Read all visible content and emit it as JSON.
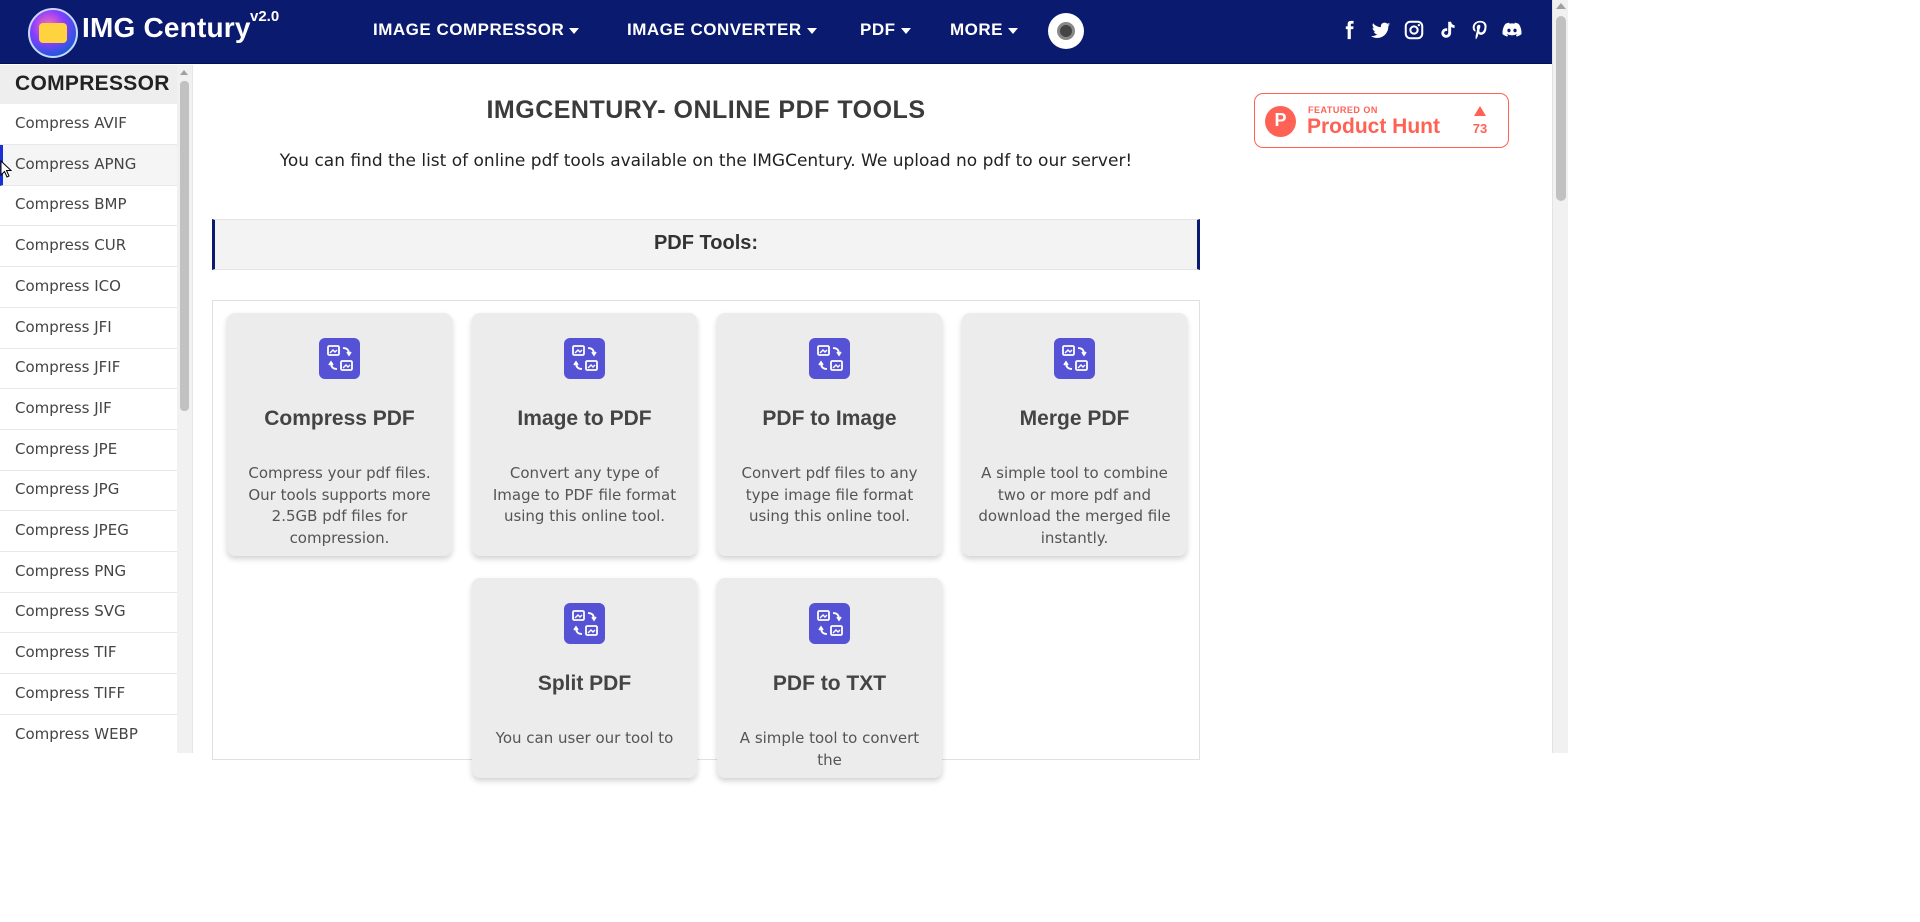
{
  "brand": {
    "name": "IMG Century",
    "version": "v2.0"
  },
  "nav": {
    "items": [
      {
        "label": "IMAGE COMPRESSOR"
      },
      {
        "label": "IMAGE CONVERTER"
      },
      {
        "label": "PDF"
      },
      {
        "label": "MORE"
      }
    ],
    "theme_toggle_icon": "theme-toggle-icon",
    "social_icons": [
      "facebook-icon",
      "twitter-icon",
      "instagram-icon",
      "tiktok-icon",
      "pinterest-icon",
      "discord-icon"
    ]
  },
  "sidebar": {
    "title": "COMPRESSOR",
    "items": [
      {
        "label": "Compress AVIF"
      },
      {
        "label": "Compress APNG"
      },
      {
        "label": "Compress BMP"
      },
      {
        "label": "Compress CUR"
      },
      {
        "label": "Compress ICO"
      },
      {
        "label": "Compress JFI"
      },
      {
        "label": "Compress JFIF"
      },
      {
        "label": "Compress JIF"
      },
      {
        "label": "Compress JPE"
      },
      {
        "label": "Compress JPG"
      },
      {
        "label": "Compress JPEG"
      },
      {
        "label": "Compress PNG"
      },
      {
        "label": "Compress SVG"
      },
      {
        "label": "Compress TIF"
      },
      {
        "label": "Compress TIFF"
      },
      {
        "label": "Compress WEBP"
      }
    ],
    "active_item": "Compress APNG"
  },
  "main": {
    "title": "IMGCENTURY- ONLINE PDF TOOLS",
    "description": "You can find the list of online pdf tools available on the IMGCentury. We upload no pdf to our server!",
    "section_title": "PDF Tools:",
    "cards": [
      {
        "title": "Compress PDF",
        "description": "Compress your pdf files. Our tools supports more 2.5GB pdf files for compression.",
        "icon": "image-convert-icon"
      },
      {
        "title": "Image to PDF",
        "description": "Convert any type of Image to PDF file format using this online tool.",
        "icon": "image-convert-icon"
      },
      {
        "title": "PDF to Image",
        "description": "Convert pdf files to any type image file format using this online tool.",
        "icon": "image-convert-icon"
      },
      {
        "title": "Merge PDF",
        "description": "A simple tool to combine two or more pdf and download the merged file instantly.",
        "icon": "image-convert-icon"
      },
      {
        "title": "Split PDF",
        "description": "You can user our tool to",
        "icon": "image-convert-icon"
      },
      {
        "title": "PDF to TXT",
        "description": "A simple tool to convert the",
        "icon": "image-convert-icon"
      }
    ]
  },
  "product_hunt": {
    "featured_label": "FEATURED ON",
    "name": "Product Hunt",
    "upvotes": "73",
    "color": "#ff6154"
  },
  "colors": {
    "nav_background": "#0a1a6e",
    "card_icon": "#5552d6",
    "active_indicator": "#1b2fd8"
  }
}
